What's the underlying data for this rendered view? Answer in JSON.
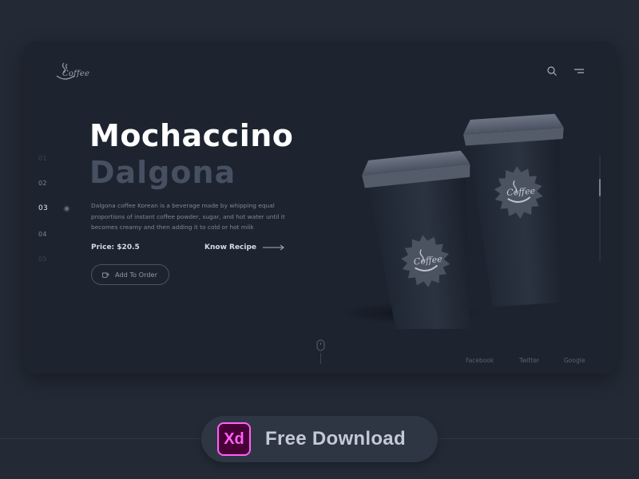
{
  "brand": {
    "logo_text": "Coffee"
  },
  "pager": {
    "items": [
      "01",
      "02",
      "03",
      "04",
      "05"
    ],
    "active_index": 2
  },
  "hero": {
    "title": "Mochaccino",
    "subtitle": "Dalgona",
    "description": "Dalgona coffee Korean is a beverage made by whipping equal proportions of instant coffee powder, sugar, and hot water until it becomes creamy and then adding it to cold or hot milk",
    "price": "Price: $20.5",
    "recipe_link": "Know Recipe",
    "order_button": "Add To Order"
  },
  "cups": {
    "label": "Coffee"
  },
  "scrollbar": {
    "position": 0.27
  },
  "footer": {
    "social": [
      "Facebook",
      "Twitter",
      "Google"
    ]
  },
  "download": {
    "badge": "Xd",
    "label": "Free Download"
  },
  "icons": [
    "coffee-logo-icon",
    "search-icon",
    "menu-icon",
    "arrow-right-icon",
    "cup-icon",
    "mouse-scroll-icon",
    "adobe-xd-icon"
  ],
  "colors": {
    "background": "#232a35",
    "card": "#1d2430",
    "xd_accent": "#ff61f6",
    "xd_fill": "#470137"
  }
}
